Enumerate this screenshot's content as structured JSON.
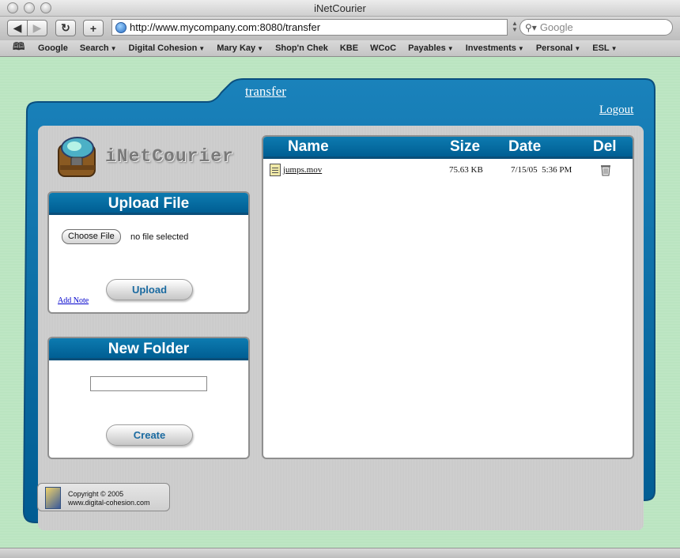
{
  "browser": {
    "window_title": "iNetCourier",
    "url": "http://www.mycompany.com:8080/transfer",
    "search_placeholder": "Google",
    "bookmarks": [
      {
        "label": "Google",
        "menu": false
      },
      {
        "label": "Search",
        "menu": true
      },
      {
        "label": "Digital Cohesion",
        "menu": true
      },
      {
        "label": "Mary Kay",
        "menu": true
      },
      {
        "label": "Shop'n Chek",
        "menu": false
      },
      {
        "label": "KBE",
        "menu": false
      },
      {
        "label": "WCoC",
        "menu": false
      },
      {
        "label": "Payables",
        "menu": true
      },
      {
        "label": "Investments",
        "menu": true
      },
      {
        "label": "Personal",
        "menu": true
      },
      {
        "label": "ESL",
        "menu": true
      }
    ]
  },
  "app": {
    "tab_label": "transfer",
    "logout_label": "Logout",
    "logo_text": "iNetCourier",
    "upload": {
      "title": "Upload File",
      "choose_label": "Choose File",
      "file_status": "no file selected",
      "upload_label": "Upload",
      "add_note_label": "Add Note"
    },
    "new_folder": {
      "title": "New Folder",
      "input_value": "",
      "create_label": "Create"
    },
    "files": {
      "columns": {
        "name": "Name",
        "size": "Size",
        "date": "Date",
        "del": "Del"
      },
      "rows": [
        {
          "name": "jumps.mov",
          "size": "75.63 KB",
          "date": "7/15/05  5:36 PM"
        }
      ]
    },
    "footer": {
      "line1": "Copyright © 2005",
      "line2": "www.digital-cohesion.com"
    }
  },
  "colors": {
    "frame_blue": "#0a6aa0",
    "page_green": "#b9e3bf",
    "panel_header": "#0d7bb0"
  }
}
